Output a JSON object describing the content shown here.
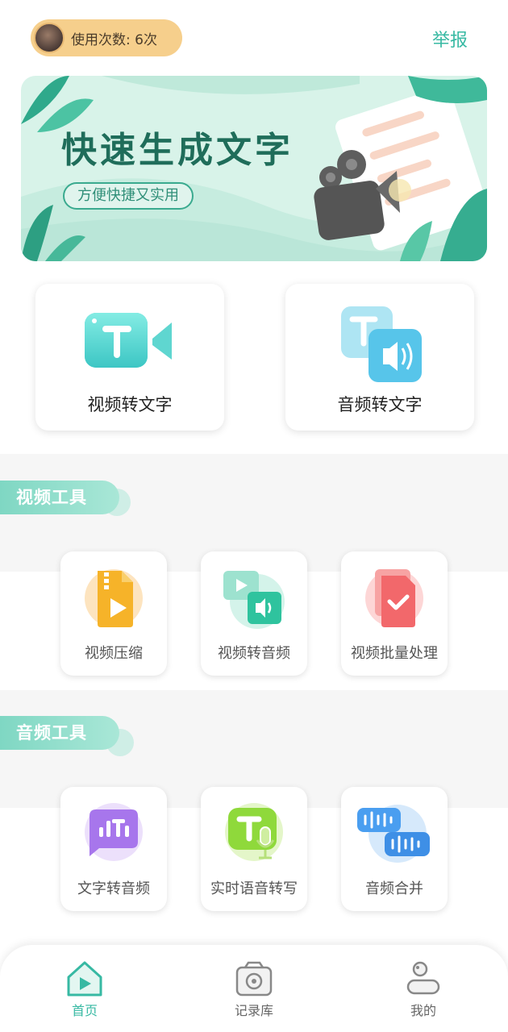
{
  "header": {
    "usage_text": "使用次数: 6次",
    "report_label": "举报"
  },
  "banner": {
    "title": "快速生成文字",
    "subtitle": "方便快捷又实用"
  },
  "main_actions": [
    {
      "label": "视频转文字",
      "icon": "video-to-text-icon"
    },
    {
      "label": "音频转文字",
      "icon": "audio-to-text-icon"
    }
  ],
  "sections": {
    "video": {
      "title": "视频工具",
      "tools": [
        {
          "label": "视频压缩",
          "icon": "zip-video-icon"
        },
        {
          "label": "视频转音频",
          "icon": "video-audio-icon"
        },
        {
          "label": "视频批量处理",
          "icon": "batch-check-icon"
        }
      ]
    },
    "audio": {
      "title": "音频工具",
      "tools": [
        {
          "label": "文字转音频",
          "icon": "text-audio-icon"
        },
        {
          "label": "实时语音转写",
          "icon": "mic-text-icon"
        },
        {
          "label": "音频合并",
          "icon": "merge-audio-icon"
        }
      ]
    }
  },
  "bottom_nav": [
    {
      "label": "首页",
      "icon": "home-icon",
      "active": true
    },
    {
      "label": "记录库",
      "icon": "archive-icon",
      "active": false
    },
    {
      "label": "我的",
      "icon": "profile-icon",
      "active": false
    }
  ],
  "colors": {
    "accent": "#37b9a3",
    "pill": "#f6cf8c",
    "banner_bg": "#d8f3e9"
  }
}
